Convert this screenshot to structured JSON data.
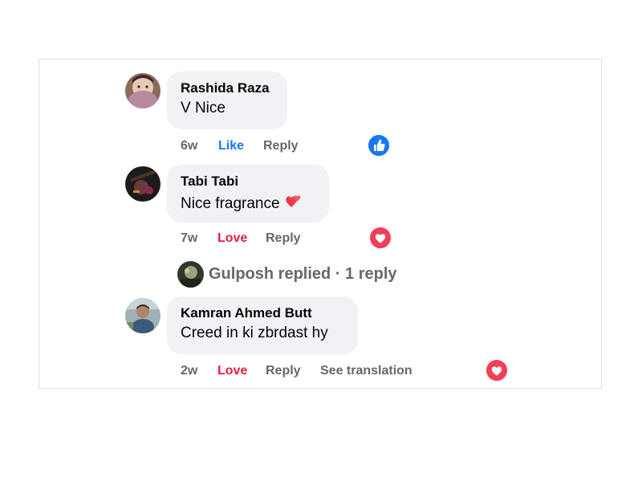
{
  "colors": {
    "like_blue": "#1877f2",
    "love_red": "#e41e3f",
    "meta_gray": "#65676b",
    "bubble_bg": "#f0f2f5"
  },
  "comments": [
    {
      "author": "Rashida Raza",
      "text": "V Nice",
      "time": "6w",
      "reaction_label": "Like",
      "reply_label": "Reply",
      "reaction_icon": "like-icon"
    },
    {
      "author": "Tabi Tabi",
      "text": "Nice fragrance",
      "emoji": "two-hearts-emoji",
      "time": "7w",
      "reaction_label": "Love",
      "reply_label": "Reply",
      "reaction_icon": "love-icon"
    },
    {
      "author": "Kamran Ahmed Butt",
      "text": "Creed in ki zbrdast hy",
      "time": "2w",
      "reaction_label": "Love",
      "reply_label": "Reply",
      "translate_label": "See translation",
      "reaction_icon": "love-icon"
    }
  ],
  "replies_summary": {
    "text": "Gulposh replied · 1 reply"
  }
}
